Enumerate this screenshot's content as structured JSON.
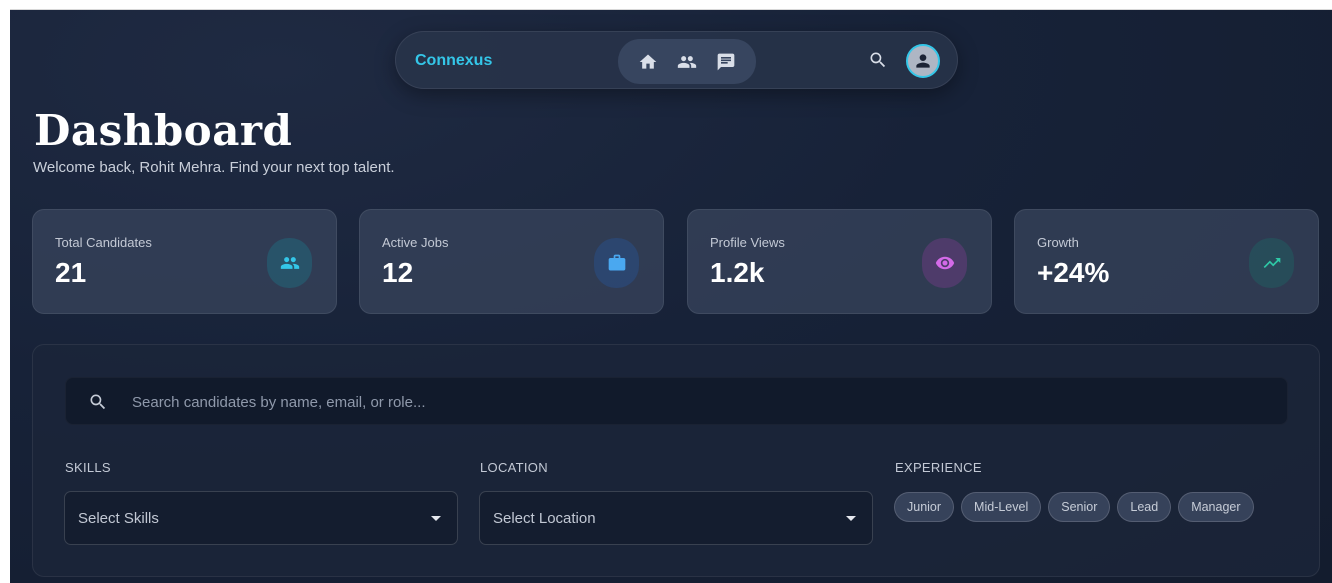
{
  "nav": {
    "brand": "Connexus",
    "icons": [
      "home-icon",
      "people-icon",
      "chat-icon"
    ],
    "search_icon": "search-icon",
    "avatar_icon": "person-icon",
    "accent": "#34c6e8"
  },
  "header": {
    "title": "Dashboard",
    "subtitle": "Welcome back, Rohit Mehra. Find your next top talent."
  },
  "stats": [
    {
      "label": "Total Candidates",
      "value": "21",
      "icon": "people-icon",
      "icon_color": "#34c6e8"
    },
    {
      "label": "Active Jobs",
      "value": "12",
      "icon": "briefcase-icon",
      "icon_color": "#4aa8f0"
    },
    {
      "label": "Profile Views",
      "value": "1.2k",
      "icon": "eye-icon",
      "icon_color": "#d46ae8"
    },
    {
      "label": "Growth",
      "value": "+24%",
      "icon": "trending-up-icon",
      "icon_color": "#2ec9a6"
    }
  ],
  "filters": {
    "search_placeholder": "Search candidates by name, email, or role...",
    "skills": {
      "label": "SKILLS",
      "value": "Select Skills"
    },
    "location": {
      "label": "LOCATION",
      "value": "Select Location"
    },
    "experience": {
      "label": "EXPERIENCE",
      "options": [
        "Junior",
        "Mid-Level",
        "Senior",
        "Lead",
        "Manager"
      ]
    }
  }
}
